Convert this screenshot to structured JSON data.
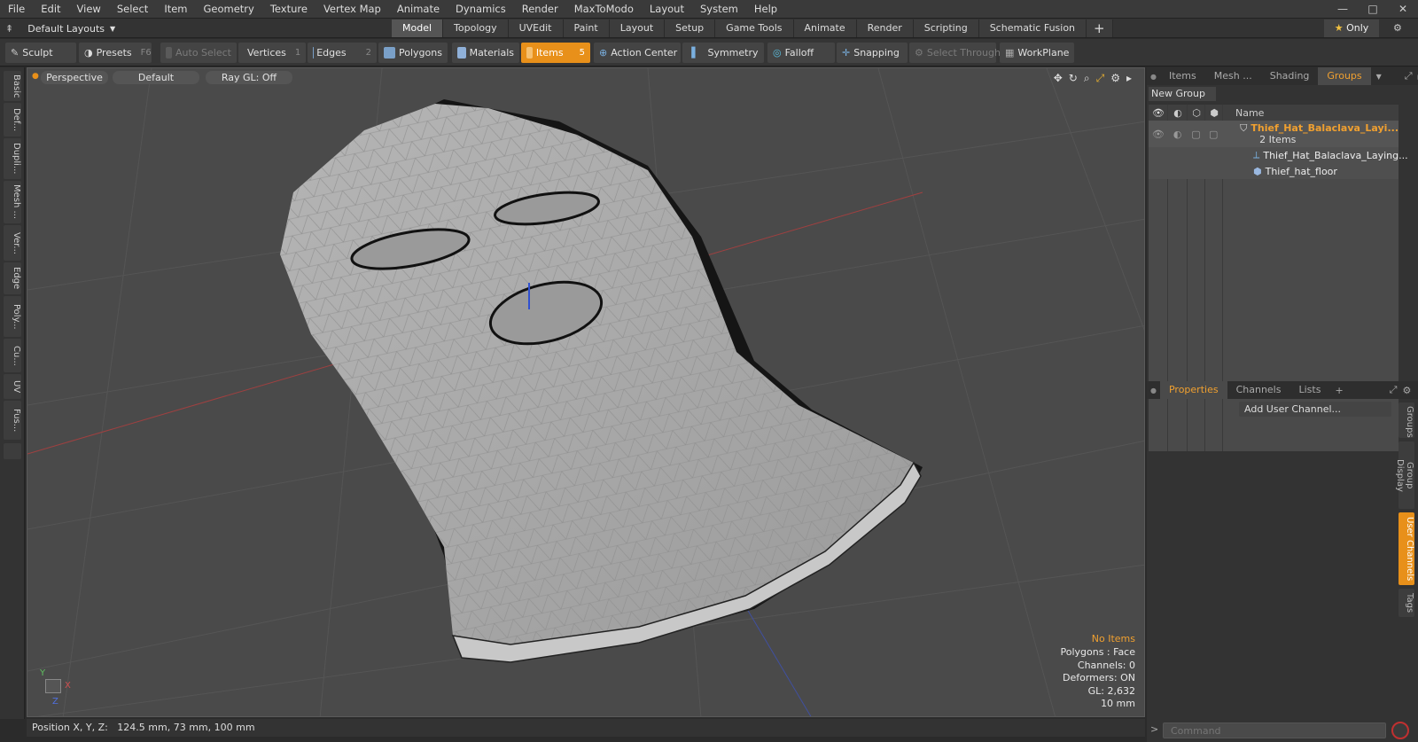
{
  "menubar": {
    "items": [
      "File",
      "Edit",
      "View",
      "Select",
      "Item",
      "Geometry",
      "Texture",
      "Vertex Map",
      "Animate",
      "Dynamics",
      "Render",
      "MaxToModo",
      "Layout",
      "System",
      "Help"
    ]
  },
  "layout_selector": {
    "label": "Default Layouts"
  },
  "mode_tabs": [
    "Model",
    "Topology",
    "UVEdit",
    "Paint",
    "Layout",
    "Setup",
    "Game Tools",
    "Animate",
    "Render",
    "Scripting",
    "Schematic Fusion"
  ],
  "only_button": "Only",
  "toolbar": {
    "sculpt": "Sculpt",
    "presets": "Presets",
    "presets_key": "F6",
    "auto_select": "Auto Select",
    "vertices": "Vertices",
    "vertices_key": "1",
    "edges": "Edges",
    "edges_key": "2",
    "polygons": "Polygons",
    "materials": "Materials",
    "items": "Items",
    "items_key": "5",
    "action_center": "Action Center",
    "symmetry": "Symmetry",
    "falloff": "Falloff",
    "snapping": "Snapping",
    "select_through": "Select Through",
    "workplane": "WorkPlane"
  },
  "left_tabs": [
    "Basic",
    "Def...",
    "Dupli...",
    "Mesh ...",
    "Ver...",
    "Edge",
    "Poly...",
    "Cu...",
    "UV",
    "Fus..."
  ],
  "viewport": {
    "view_label": "Perspective",
    "shading_label": "Default",
    "raygl_label": "Ray GL: Off",
    "info": {
      "selection": "No Items",
      "polygons": "Polygons : Face",
      "channels": "Channels: 0",
      "deformers": "Deformers: ON",
      "gl": "GL: 2,632",
      "scale": "10 mm"
    },
    "axis": {
      "y": "Y",
      "x": "X",
      "z": "Z"
    }
  },
  "statusbar": {
    "position": "Position X, Y, Z:   124.5 mm, 73 mm, 100 mm"
  },
  "right_panel": {
    "top_tabs": [
      "Items",
      "Mesh ...",
      "Shading",
      "Groups"
    ],
    "new_group": "New Group",
    "name_header": "Name",
    "group": {
      "name": "Thief_Hat_Balaclava_Layi...",
      "count": "2 Items"
    },
    "children": [
      "Thief_Hat_Balaclava_Laying...",
      "Thief_hat_floor"
    ],
    "bottom_tabs": [
      "Properties",
      "Channels",
      "Lists"
    ],
    "add_user_channel": "Add User Channel...",
    "side_tabs": [
      "Groups",
      "Group Display",
      "User Channels",
      "Tags"
    ],
    "command_placeholder": "Command"
  },
  "colors": {
    "accent": "#e8901a",
    "group_name": "#f0a030"
  }
}
